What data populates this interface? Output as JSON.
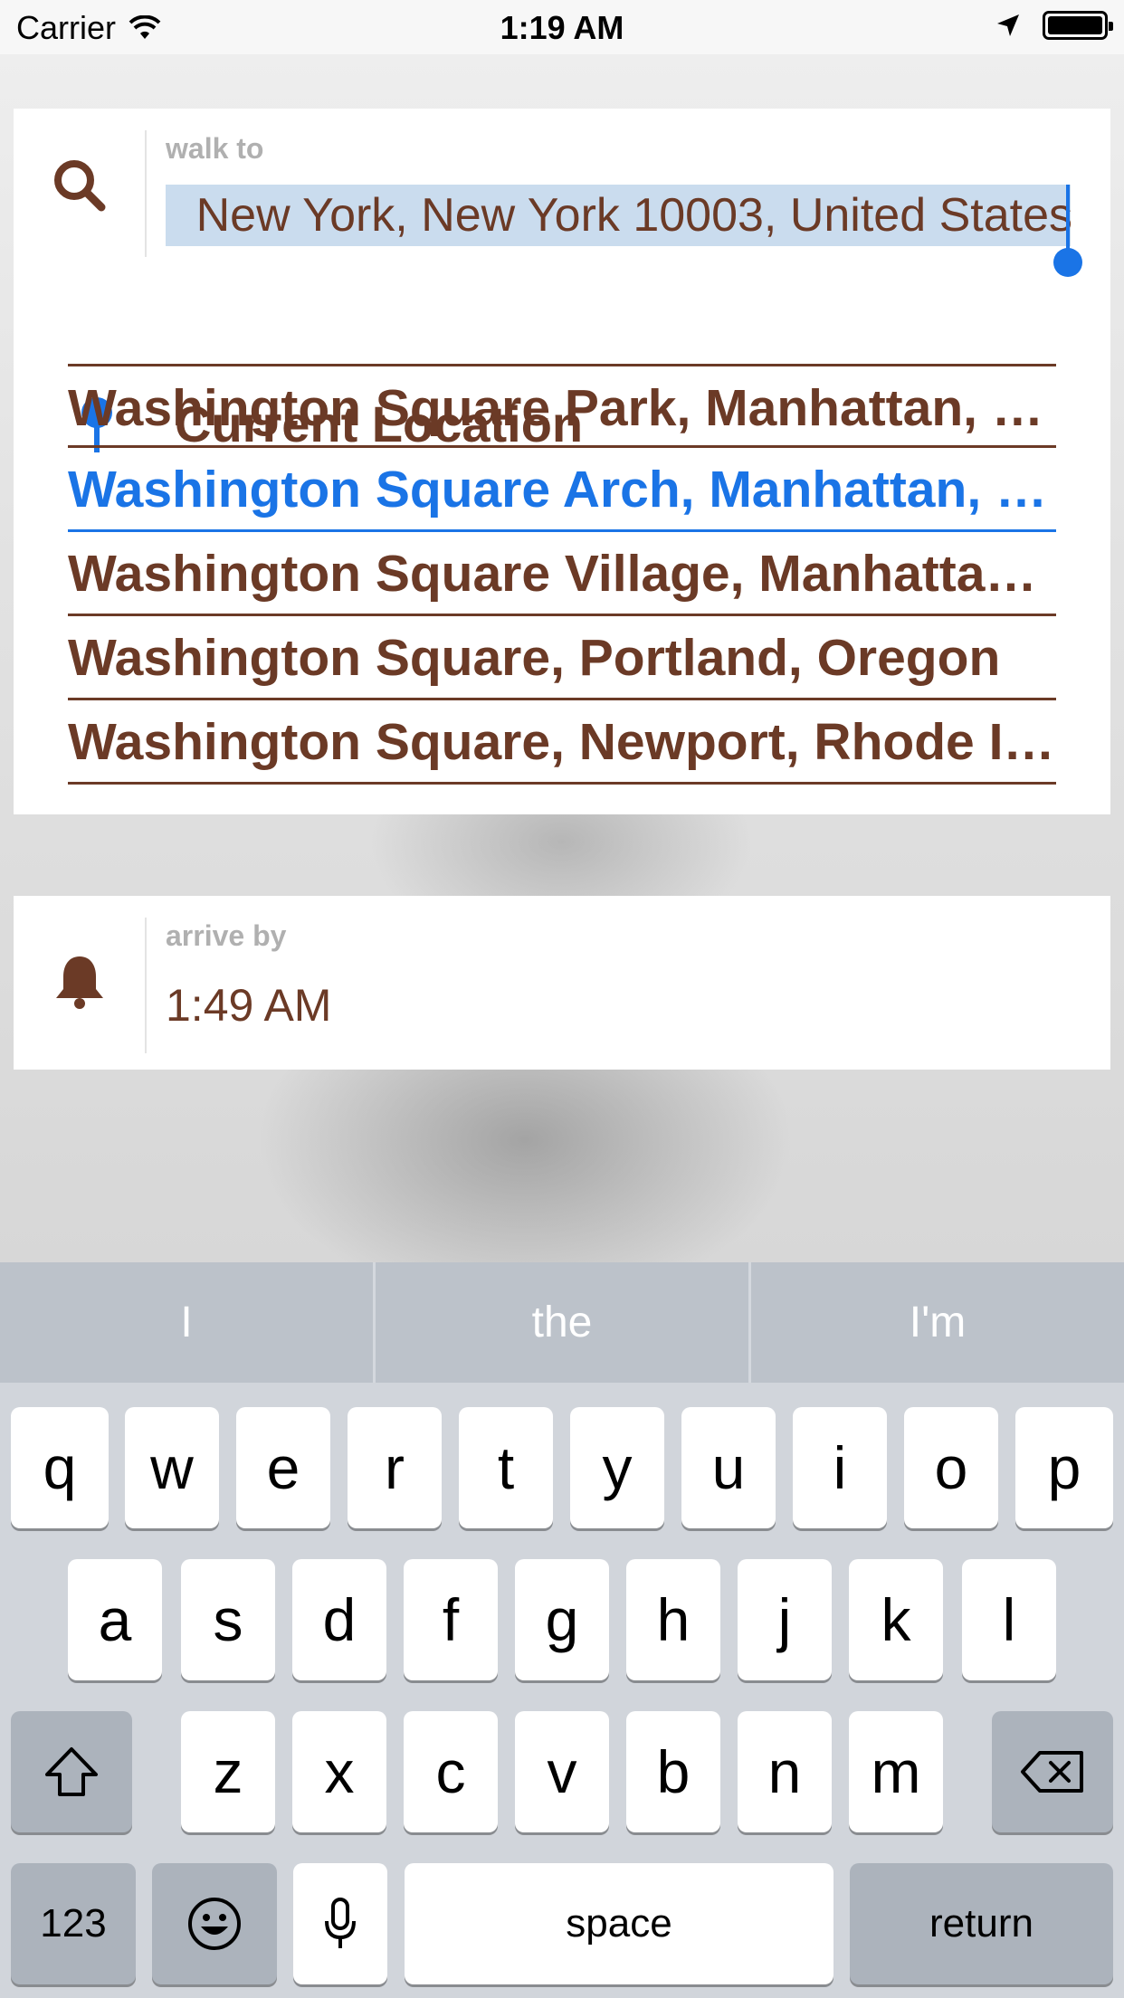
{
  "status_bar": {
    "carrier": "Carrier",
    "time": "1:19 AM"
  },
  "search": {
    "label": "walk to",
    "value": "New York, New York 10003, United States",
    "current_location": "Current Location",
    "suggestions": [
      "Washington Square Park, Manhattan, New York",
      "Washington Square Arch, Manhattan, New York",
      "Washington Square Village, Manhattan, New York",
      "Washington Square, Portland, Oregon",
      "Washington Square, Newport, Rhode Island"
    ]
  },
  "arrive": {
    "label": "arrive by",
    "value": "1:49 AM"
  },
  "keyboard": {
    "predictions": [
      "I",
      "the",
      "I'm"
    ],
    "row1": [
      "q",
      "w",
      "e",
      "r",
      "t",
      "y",
      "u",
      "i",
      "o",
      "p"
    ],
    "row2": [
      "a",
      "s",
      "d",
      "f",
      "g",
      "h",
      "j",
      "k",
      "l"
    ],
    "row3": [
      "z",
      "x",
      "c",
      "v",
      "b",
      "n",
      "m"
    ],
    "numbers_label": "123",
    "space_label": "space",
    "return_label": "return"
  },
  "colors": {
    "accent": "#1a74e6",
    "brown": "#6b3a26"
  }
}
